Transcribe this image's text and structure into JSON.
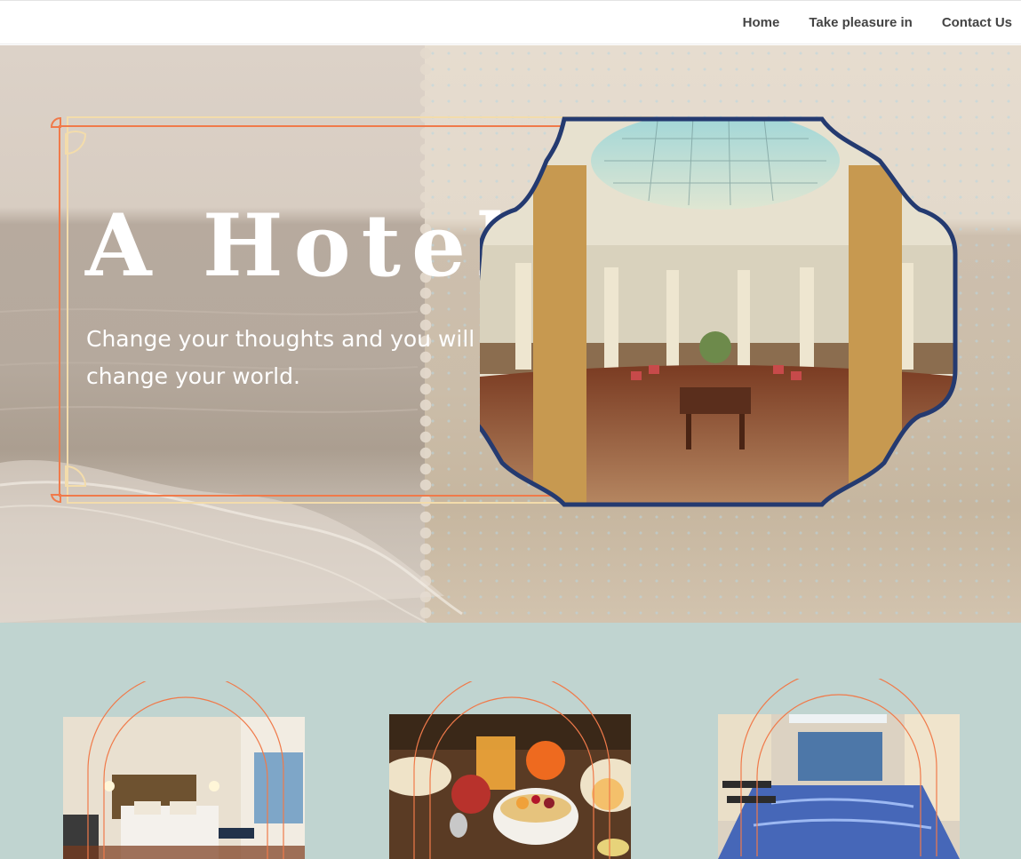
{
  "nav": {
    "items": [
      "Home",
      "Take pleasure in",
      "Contact Us"
    ]
  },
  "hero": {
    "title": "A Hotel",
    "subtitle": "Change your thoughts and you will change your world.",
    "photo_alt": "Domed hotel lobby with grand piano"
  },
  "features": {
    "cards": [
      {
        "alt": "Hotel bedroom with double bed"
      },
      {
        "alt": "Breakfast table with fruit and juice"
      },
      {
        "alt": "Indoor swimming pool"
      }
    ]
  },
  "colors": {
    "accent_orange": "#f07a4a",
    "frame_cream": "#f3dcab",
    "photo_border_navy": "#243a70",
    "section_teal": "#c0d4d0"
  }
}
